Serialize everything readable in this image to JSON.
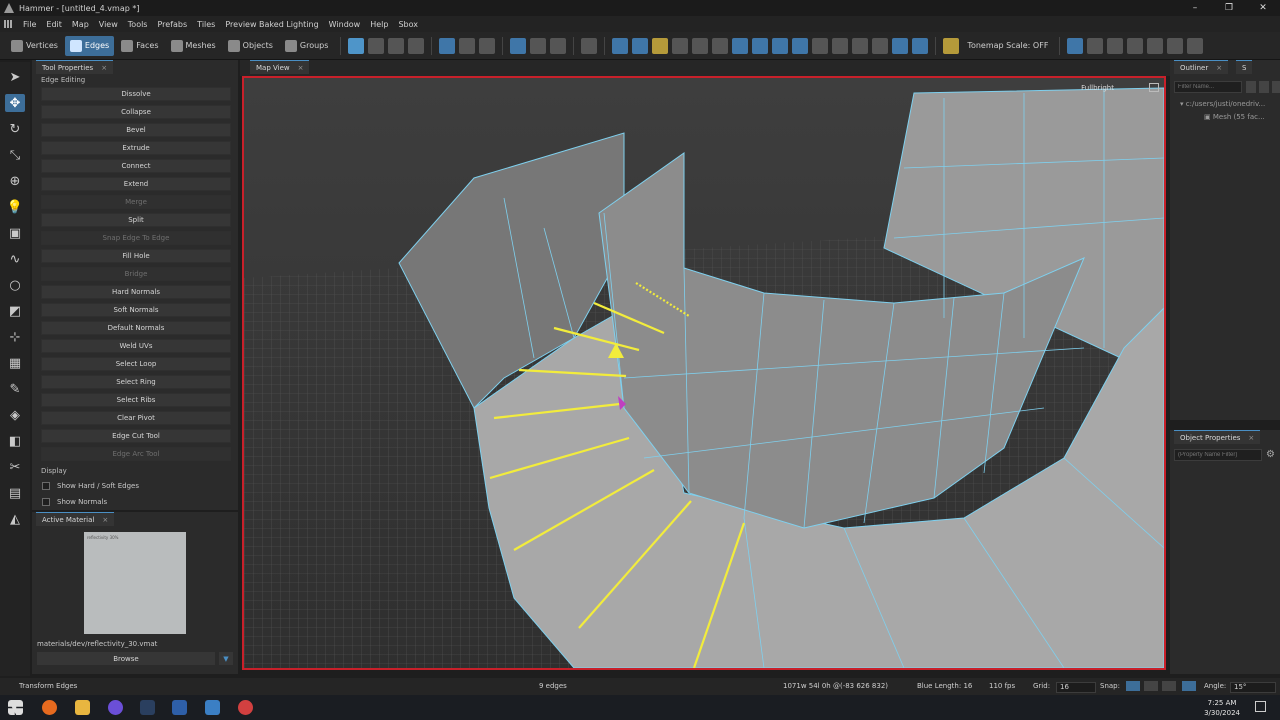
{
  "window": {
    "title": "Hammer - [untitled_4.vmap *]",
    "controls": [
      "–",
      "❐",
      "✕"
    ]
  },
  "menu": [
    "File",
    "Edit",
    "Map",
    "View",
    "Tools",
    "Prefabs",
    "Tiles",
    "Preview Baked Lighting",
    "Window",
    "Help",
    "Sbox"
  ],
  "modes": [
    {
      "label": "Vertices",
      "icon": "vertices-icon",
      "active": false
    },
    {
      "label": "Edges",
      "icon": "edges-icon",
      "active": true
    },
    {
      "label": "Faces",
      "icon": "faces-icon",
      "active": false
    },
    {
      "label": "Meshes",
      "icon": "meshes-icon",
      "active": false
    },
    {
      "label": "Objects",
      "icon": "objects-icon",
      "active": false
    },
    {
      "label": "Groups",
      "icon": "groups-icon",
      "active": false
    }
  ],
  "toolbar": {
    "tonemap": "Tonemap Scale: OFF"
  },
  "tool_properties": {
    "tab": "Tool Properties",
    "section": "Edge Editing",
    "buttons": [
      {
        "label": "Dissolve",
        "enabled": true
      },
      {
        "label": "Collapse",
        "enabled": true
      },
      {
        "label": "Bevel",
        "enabled": true
      },
      {
        "label": "Extrude",
        "enabled": true
      },
      {
        "label": "Connect",
        "enabled": true
      },
      {
        "label": "Extend",
        "enabled": true
      },
      {
        "label": "Merge",
        "enabled": false
      },
      {
        "label": "Split",
        "enabled": true
      },
      {
        "label": "Snap Edge To Edge",
        "enabled": false
      },
      {
        "label": "Fill Hole",
        "enabled": true
      },
      {
        "label": "Bridge",
        "enabled": false
      },
      {
        "label": "Hard Normals",
        "enabled": true
      },
      {
        "label": "Soft Normals",
        "enabled": true
      },
      {
        "label": "Default Normals",
        "enabled": true
      },
      {
        "label": "Weld UVs",
        "enabled": true
      },
      {
        "label": "Select Loop",
        "enabled": true
      },
      {
        "label": "Select Ring",
        "enabled": true
      },
      {
        "label": "Select Ribs",
        "enabled": true
      },
      {
        "label": "Clear Pivot",
        "enabled": true
      },
      {
        "label": "Edge Cut Tool",
        "enabled": true
      },
      {
        "label": "Edge Arc Tool",
        "enabled": false
      }
    ],
    "display_label": "Display",
    "checkboxes": [
      {
        "label": "Show Hard / Soft Edges",
        "checked": false
      },
      {
        "label": "Show Normals",
        "checked": false
      }
    ]
  },
  "active_material": {
    "tab": "Active Material",
    "thumb_text": "reflectivity 30%",
    "path": "materials/dev/reflectivity_30.vmat",
    "browse": "Browse"
  },
  "map_view": {
    "tab": "Map View",
    "fullbright": "Fullbright"
  },
  "outliner": {
    "tab": "Outliner",
    "tab2": "S",
    "filter_placeholder": "Filter Name...",
    "root": "c:/users/justi/onedriv...",
    "child": "Mesh (55 fac..."
  },
  "object_properties": {
    "tab": "Object Properties",
    "filter_placeholder": "(Property Name Filter)"
  },
  "status": {
    "tool": "Transform Edges",
    "selection": "9 edges",
    "stats": "1071w 54l 0h @(-83 626 832)",
    "blue_length": "Blue Length: 16",
    "fps": "110 fps",
    "grid_label": "Grid:",
    "grid_value": "16",
    "snap_label": "Snap:",
    "angle_label": "Angle:",
    "angle_value": "15°"
  },
  "taskbar": {
    "time": "7:25 AM",
    "date": "3/30/2024"
  },
  "colors": {
    "accent": "#3d6e99",
    "selection": "#f2ec3c",
    "wire": "#7fd0ee",
    "viewport_border": "#c8202a"
  }
}
